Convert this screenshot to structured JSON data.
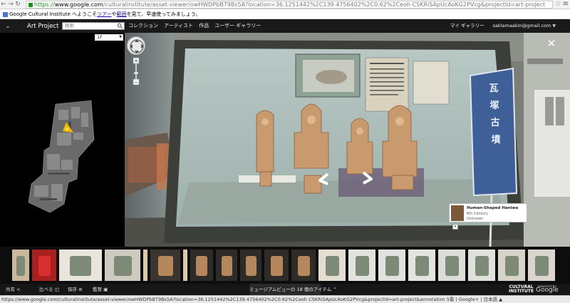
{
  "browser": {
    "url_https": "https://",
    "url_host": "www.google.com",
    "url_path": "/culturalinstitute/asset-viewer/owHWDPbBT9Bs5A?location=36.1251442%2C139.4756402%2C0.62%2Ceoh CSKRiSApUcAoKG2PVcg&projectId=art-project"
  },
  "bookmark_bar": {
    "prefix": "Google Cultural Institute へようこそ",
    "link1": "ツアー",
    "mid": "や",
    "link2": "範囲",
    "suffix": "を見て、早速使ってみましょう。"
  },
  "header": {
    "brand": "Art Project",
    "search_placeholder": "検索",
    "menu": [
      "コレクション",
      "アーティスト",
      "作品",
      "ユーザー ギャラリー"
    ],
    "my_gallery": "マイ ギャラリー",
    "account": "saklamaakm@gmail.com"
  },
  "map": {
    "floor": "1F"
  },
  "viewer": {
    "placard_text": "瓦塚古墳",
    "info_card": {
      "title": "Human-Shaped Haniwa",
      "period": "6th Century",
      "artist": "Unknown"
    }
  },
  "toolbar": {
    "share": "共有",
    "compare": "比べる",
    "save": "保存",
    "view": "鑑賞",
    "center_tab": "ミュージアムビューの 18 個のアイテム",
    "cultural": "CULTURAL",
    "institute": "INSTITUTE",
    "powered": "powered by",
    "google": "Google"
  },
  "status_bar": {
    "text": "https://www.google.com/culturalinstitute/asset-viewer/owHWDPbBT9Bs5A?location=36.1251442%2C139.4756402%2C0.62%2Ceoh CSKRiSApUcAoKG2PVcg&projectId=art-project&annotation 5看 | Google+ | 日本語 ▲"
  },
  "colors": {
    "header_bg": "#1a1a1a",
    "strip_bg": "#0d0d0d",
    "placard_blue": "#3f5f98"
  },
  "thumbnails": [
    {
      "name": "thumb-haniwa-tall",
      "w": 24,
      "bg": "#c9b89a"
    },
    {
      "name": "thumb-red-cloth",
      "w": 34,
      "bg": "#a82020"
    },
    {
      "name": "thumb-helmet-red",
      "w": 60,
      "bg": "#e9e4dc"
    },
    {
      "name": "thumb-fragments",
      "w": 50,
      "bg": "#cfcabf"
    },
    {
      "name": "thumb-bar",
      "w": 6,
      "bg": "#d8c9a8"
    },
    {
      "name": "thumb-house-haniwa",
      "w": 42,
      "bg": "#3a3530"
    },
    {
      "name": "thumb-bar-2",
      "w": 6,
      "bg": "#d8c9a8"
    },
    {
      "name": "thumb-figure-1",
      "w": 32,
      "bg": "#2e2b28"
    },
    {
      "name": "thumb-figure-2",
      "w": 30,
      "bg": "#2e2b28"
    },
    {
      "name": "thumb-figure-3",
      "w": 30,
      "bg": "#2e2b28"
    },
    {
      "name": "thumb-figure-4",
      "w": 34,
      "bg": "#2e2b28"
    },
    {
      "name": "thumb-figure-5",
      "w": 34,
      "bg": "#2e2b28"
    },
    {
      "name": "thumb-face",
      "w": 38,
      "bg": "#e4ddd2"
    },
    {
      "name": "thumb-ornaments",
      "w": 38,
      "bg": "#e4e2de"
    },
    {
      "name": "thumb-bronze",
      "w": 38,
      "bg": "#e1e1df"
    },
    {
      "name": "thumb-beads",
      "w": 38,
      "bg": "#e4e3e0"
    },
    {
      "name": "thumb-mirror",
      "w": 38,
      "bg": "#dcdcd8"
    },
    {
      "name": "thumb-magatama",
      "w": 38,
      "bg": "#e0e0dd"
    },
    {
      "name": "thumb-haniwa-small",
      "w": 38,
      "bg": "#d8d3c9"
    },
    {
      "name": "thumb-head",
      "w": 38,
      "bg": "#dad6cf"
    }
  ]
}
